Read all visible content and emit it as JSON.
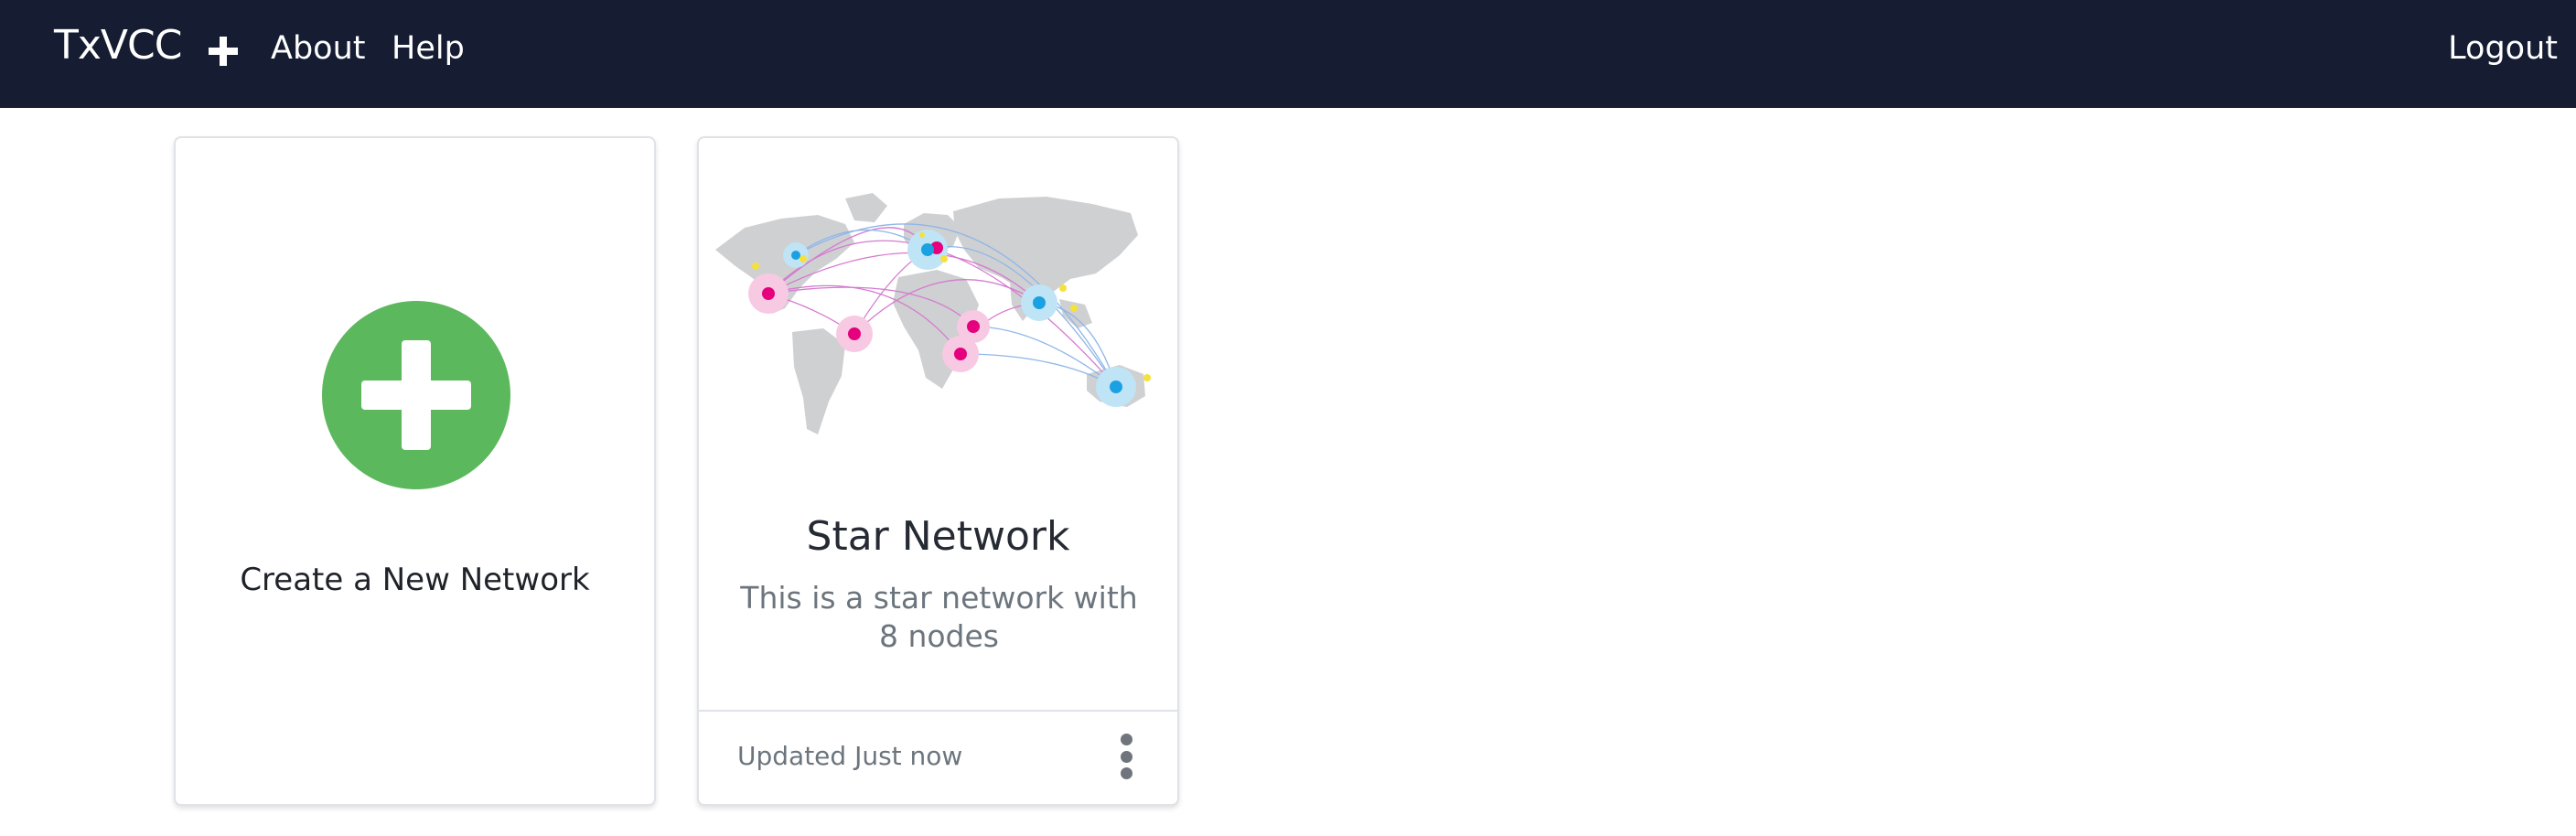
{
  "navbar": {
    "brand": "TxVCC",
    "add_icon": "plus-icon",
    "about": "About",
    "help": "Help",
    "logout": "Logout"
  },
  "cards": {
    "create": {
      "icon": "add-circle-icon",
      "label": "Create a New Network",
      "accent": "#5cb85c"
    },
    "network": {
      "image": "world-map-network",
      "title": "Star Network",
      "description": "This is a star network with 8 nodes",
      "updated": "Updated Just now",
      "menu_icon": "kebab-menu-icon"
    }
  },
  "colors": {
    "navbar_bg": "#161d33",
    "node_pink": "#e6007e",
    "node_blue": "#1ba1e2",
    "node_yellow": "#f5e13b"
  }
}
